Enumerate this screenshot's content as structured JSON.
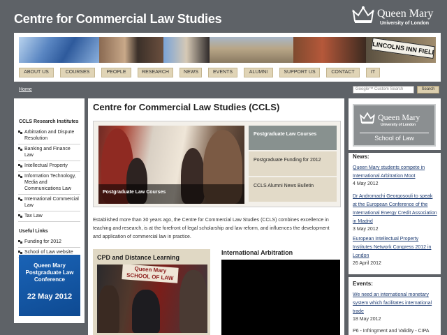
{
  "header": {
    "site_title": "Centre for Commercial Law Studies",
    "logo_name": "Queen Mary",
    "logo_sub": "University of London",
    "banner_sign": "LINCOLNS INN FIELDS"
  },
  "nav": {
    "items": [
      "ABOUT US",
      "COURSES",
      "PEOPLE",
      "RESEARCH",
      "NEWS",
      "EVENTS",
      "ALUMNI",
      "SUPPORT US",
      "CONTACT",
      "IT"
    ]
  },
  "subbar": {
    "home": "Home",
    "search_placeholder": "Google™ Custom Search",
    "search_button": "Search"
  },
  "left": {
    "institutes_heading": "CCLS Research Institutes",
    "institutes": [
      "Arbitration and Dispute Resolution",
      "Banking and Finance Law",
      "Intellectual Property",
      "Information Technology, Media and Communications Law",
      "International Commercial Law",
      "Tax Law"
    ],
    "useful_heading": "Useful Links",
    "useful": [
      "Funding for 2012",
      "School of Law website"
    ],
    "conference": {
      "line1": "Queen Mary",
      "line2": "Postgraduate Law",
      "line3": "Conference",
      "date": "22 May 2012"
    }
  },
  "main": {
    "title": "Centre for Commercial Law Studies (CCLS)",
    "feature_caption": "Postgraduate Law Courses",
    "feature_tabs": [
      "Postgraduate Law Courses",
      "Postgraduate Funding for 2012",
      "CCLS Alumni News Bulletin"
    ],
    "intro": "Established more than 30 years ago, the Centre for Commercial Law Studies (CCLS) combines excellence in teaching and research, is at the forefront of legal scholarship and law reform, and influences the development and application of commercial law in practice.",
    "cpd_heading": "CPD and Distance Learning",
    "cpd_sign_line1": "Queen Mary",
    "cpd_sign_line2": "SCHOOL OF LAW",
    "arb_heading": "International Arbitration"
  },
  "right": {
    "sol_name": "Queen Mary",
    "sol_sub": "University of London",
    "sol_school": "School of Law",
    "news_heading": "News:",
    "news": [
      {
        "title": "Queen Mary students compete in International Arbitration Moot",
        "date": "4 May 2012"
      },
      {
        "title": "Dr Andromachi Georgosouli to speak at the European Conference of the International Energy Credit Association in Madrid",
        "date": "3 May 2012"
      },
      {
        "title": "European Intellectual Property Institutes Network Congress 2012 in London",
        "date": "26 April 2012"
      }
    ],
    "events_heading": "Events:",
    "events": [
      {
        "title": "We need an international monetary system which facilitates international trade",
        "date": "18 May 2012"
      },
      {
        "title": "P6 - Infringment and Validity - CIPA",
        "date": ""
      }
    ]
  },
  "colors": {
    "page_bg": "#5e6267",
    "nav_button": "#e0d4b6",
    "link": "#1f3d73",
    "active_tab": "#88918f",
    "conference_blue": "#1a63b6"
  }
}
